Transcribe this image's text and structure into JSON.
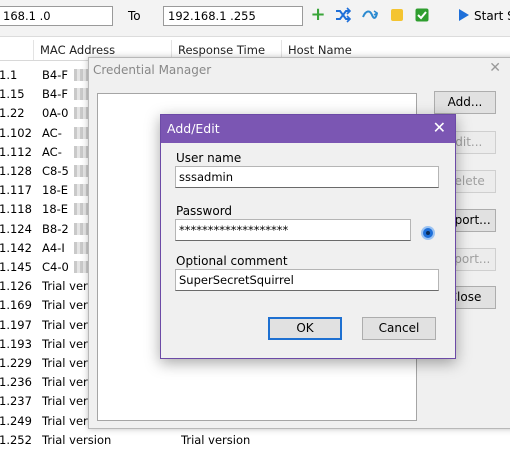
{
  "toolbar": {
    "from_ip": "168.1 .0",
    "to_label": "To",
    "to_ip": "192.168.1 .255",
    "start_label": "Start S"
  },
  "table": {
    "headers": [
      "MAC Address",
      "Response Time",
      "Host Name"
    ],
    "ip_fragments": [
      "1.1",
      "1.15",
      "1.22",
      "1.102",
      "1.112",
      "1.128",
      "1.117",
      "1.118",
      "1.124",
      "1.142",
      "1.145",
      "1.126",
      "1.169",
      "1.197",
      "1.193",
      "1.229",
      "1.236",
      "1.237",
      "1.249",
      "1.252"
    ],
    "mac_fragments": [
      "B4-F",
      "B4-F",
      "0A-0",
      "AC-",
      "AC-",
      "C8-5",
      "18-E",
      "18-E",
      "B8-2",
      "A4-I",
      "C4-0",
      "Trial versi",
      "Trial versi",
      "Trial versi",
      "Trial versi",
      "Trial versi",
      "Trial versi",
      "Trial versi",
      "Trial versi",
      "Trial version"
    ],
    "last_row_host": "Trial version"
  },
  "credential_manager": {
    "title": "Credential Manager",
    "close_glyph": "✕",
    "buttons": {
      "add": "Add...",
      "edit": "Edit...",
      "delete": "Delete",
      "import": "Import...",
      "export": "Export...",
      "close": "Close"
    }
  },
  "add_edit": {
    "title": "Add/Edit",
    "close_glyph": "✕",
    "username_label": "User name",
    "username_value": "sssadmin",
    "password_label": "Password",
    "password_value": "*******************",
    "comment_label": "Optional comment",
    "comment_value": "SuperSecretSquirrel",
    "ok_label": "OK",
    "cancel_label": "Cancel"
  },
  "icons": {
    "add": "plus-icon",
    "shuffle": "shuffle-icon",
    "wave": "wave-icon",
    "note": "note-icon",
    "check": "check-icon",
    "start": "play-icon",
    "eye": "eye-icon"
  },
  "colors": {
    "dialog_title_bar": "#7b56b3",
    "ok_button_border": "#1e70d1",
    "plus_icon": "#3aa53a",
    "shuffle_icon": "#1e6fd9",
    "note_icon": "#f4c430",
    "check_icon": "#2f9e2f",
    "play_icon": "#1e6fd9"
  }
}
